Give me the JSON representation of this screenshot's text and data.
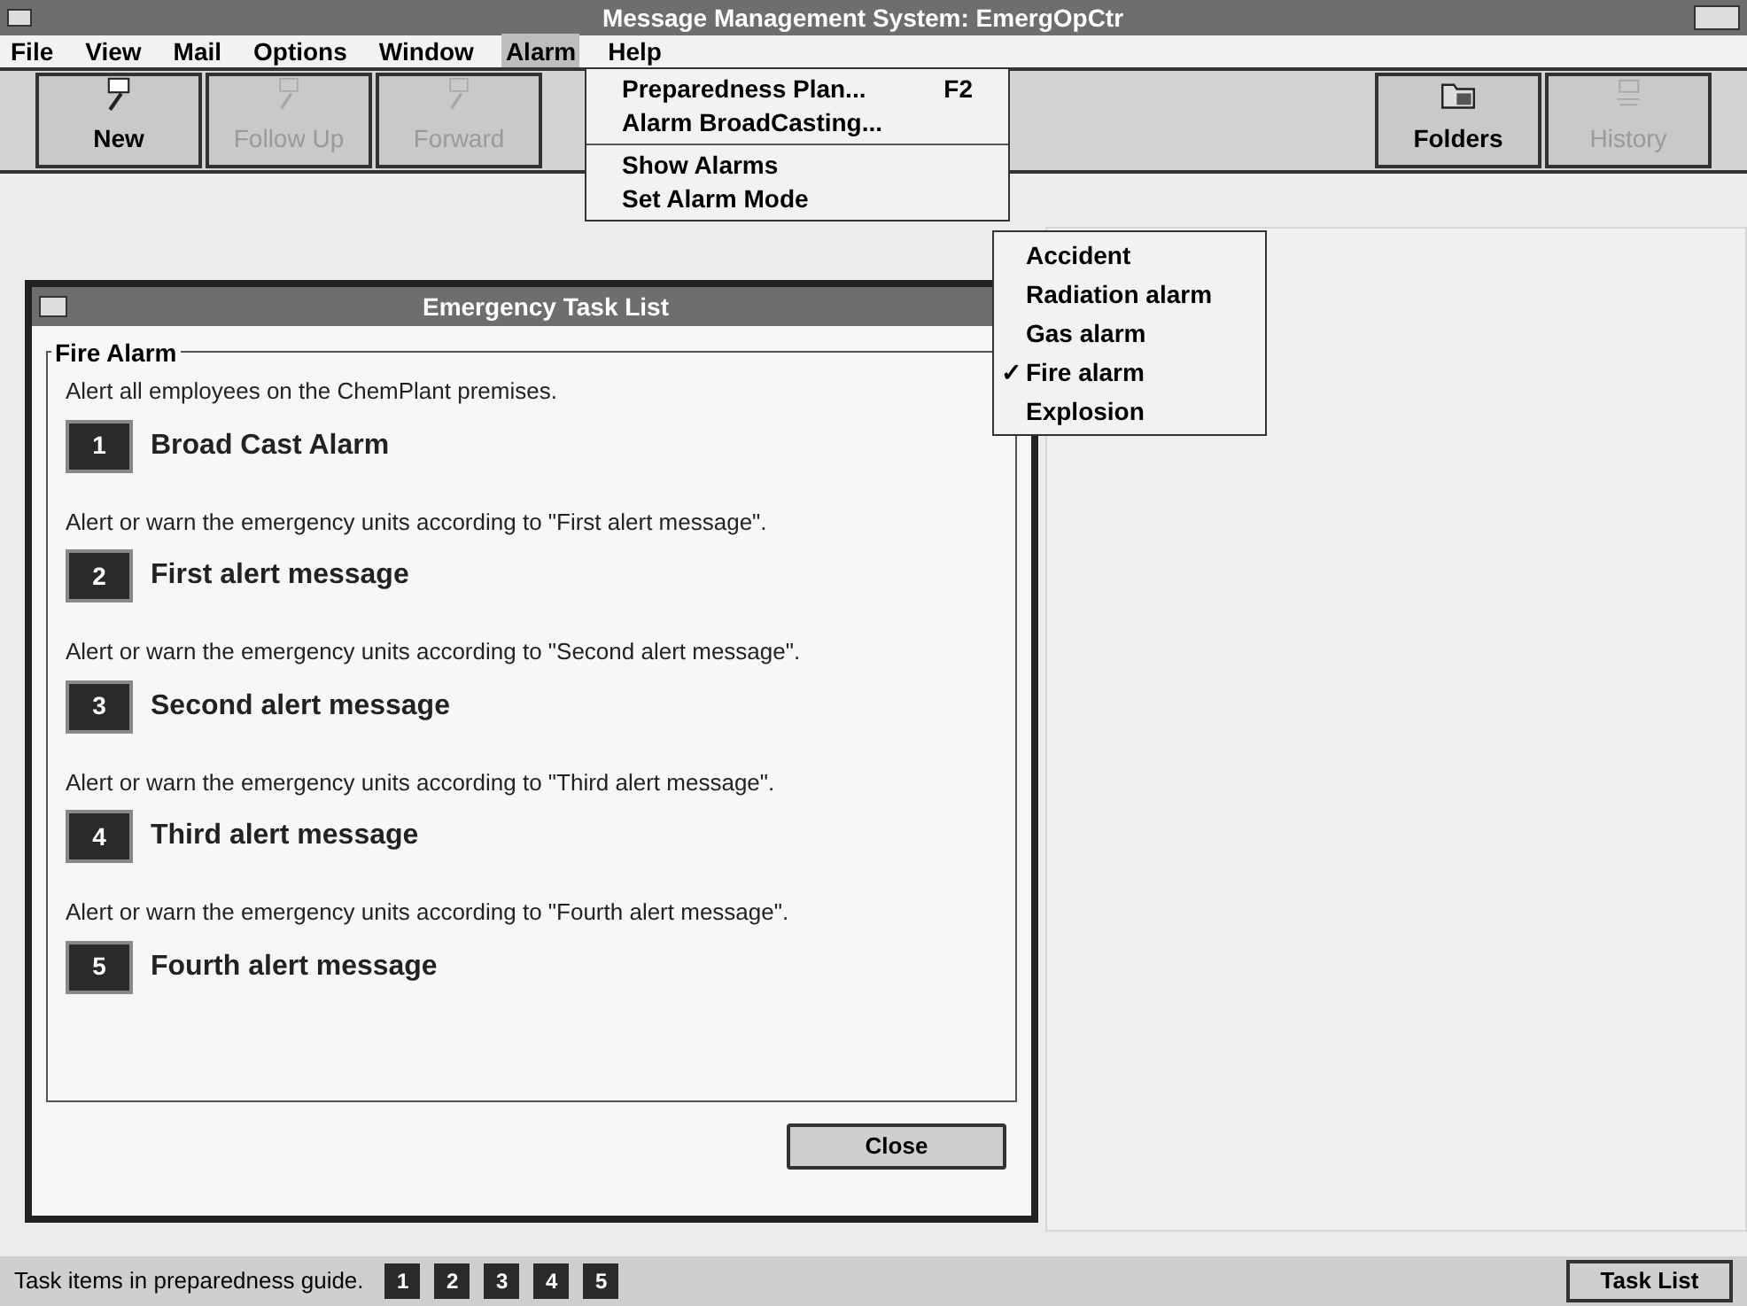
{
  "window": {
    "title": "Message Management System: EmergOpCtr"
  },
  "menu_bar": [
    {
      "label": "File",
      "selected": false
    },
    {
      "label": "View",
      "selected": false
    },
    {
      "label": "Mail",
      "selected": false
    },
    {
      "label": "Options",
      "selected": false
    },
    {
      "label": "Window",
      "selected": false
    },
    {
      "label": "Alarm",
      "selected": true
    },
    {
      "label": "Help",
      "selected": false
    }
  ],
  "toolbar_left": [
    {
      "label": "New",
      "kind": "new",
      "disabled": false
    },
    {
      "label": "Follow Up",
      "kind": "followup",
      "disabled": true
    },
    {
      "label": "Forward",
      "kind": "forward",
      "disabled": true
    }
  ],
  "toolbar_right": [
    {
      "label": "Folders",
      "kind": "folders",
      "disabled": false
    },
    {
      "label": "History",
      "kind": "history",
      "disabled": true
    }
  ],
  "alarm_menu": [
    {
      "label": "Preparedness Plan...",
      "shortcut": "F2",
      "separator_after": false
    },
    {
      "label": "Alarm BroadCasting...",
      "separator_after": true
    },
    {
      "label": "Show Alarms",
      "separator_after": false
    },
    {
      "label": "Set Alarm Mode",
      "separator_after": false
    }
  ],
  "alarm_mode_menu": [
    {
      "label": "Accident",
      "checked": false
    },
    {
      "label": "Radiation alarm",
      "checked": false
    },
    {
      "label": "Gas alarm",
      "checked": false
    },
    {
      "label": "Fire alarm",
      "checked": true
    },
    {
      "label": "Explosion",
      "checked": false
    }
  ],
  "check_mark": "✓",
  "dialog": {
    "title": "Emergency Task List",
    "group": "Fire Alarm",
    "tasks": [
      {
        "description": "Alert all employees on the ChemPlant premises.",
        "number": "1",
        "label": "Broad Cast Alarm"
      },
      {
        "description": "Alert or warn the emergency units according to \"First alert message\".",
        "number": "2",
        "label": "First alert message"
      },
      {
        "description": "Alert or warn the emergency units according to \"Second alert message\".",
        "number": "3",
        "label": "Second alert message"
      },
      {
        "description": "Alert or warn the emergency units according to \"Third alert message\".",
        "number": "4",
        "label": "Third alert message"
      },
      {
        "description": "Alert or warn the emergency units according to \"Fourth alert message\".",
        "number": "5",
        "label": "Fourth alert message"
      }
    ],
    "close_button": "Close"
  },
  "status_bar": {
    "text": "Task items in preparedness guide.",
    "steps": [
      "1",
      "2",
      "3",
      "4",
      "5"
    ],
    "button": "Task List"
  }
}
